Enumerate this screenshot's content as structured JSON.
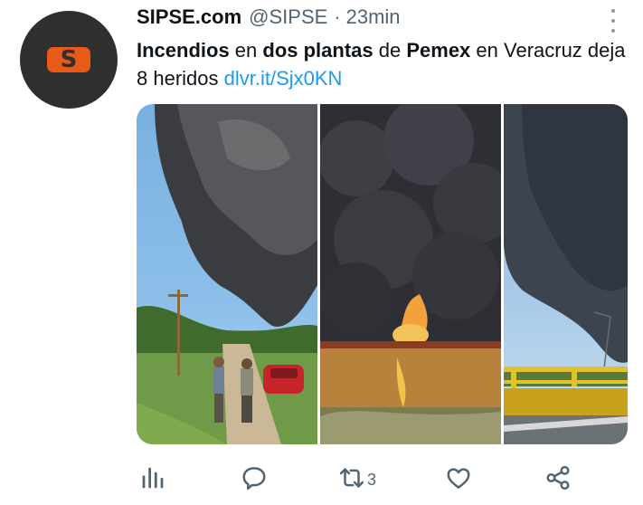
{
  "tweet": {
    "author_name": "SIPSE.com",
    "handle": "@SIPSE",
    "separator": "·",
    "time": "23min",
    "avatar_letter": "S",
    "text_parts": [
      {
        "text": "Incendios",
        "bold": true
      },
      {
        "text": " en ",
        "bold": false
      },
      {
        "text": "dos plantas",
        "bold": true
      },
      {
        "text": " de ",
        "bold": false
      },
      {
        "text": "Pemex",
        "bold": true
      },
      {
        "text": " en Veracruz deja 8 heridos ",
        "bold": false
      }
    ],
    "link": "dlvr.it/Sjx0KN",
    "retweet_count": "3"
  },
  "colors": {
    "accent": "#1d9bf0",
    "avatar_bg": "#2f2f2f",
    "logo": "#e85a1a",
    "icon": "#536471"
  },
  "icons": {
    "more": "more-vertical-icon",
    "analytics": "analytics-icon",
    "reply": "reply-icon",
    "retweet": "retweet-icon",
    "like": "heart-icon",
    "share": "share-icon"
  }
}
